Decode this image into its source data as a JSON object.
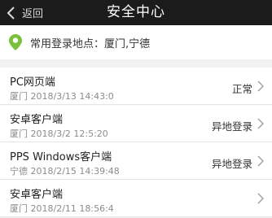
{
  "header": {
    "back_label": "返回",
    "title": "安全中心"
  },
  "location": {
    "icon": "location-pin-icon",
    "text": "常用登录地点：厦门,宁德",
    "accent": "#7bbf3a"
  },
  "devices": [
    {
      "name": "PC网页端",
      "place": "厦门",
      "time": "2018/3/13 14:43:0",
      "status": "正常"
    },
    {
      "name": "安卓客户端",
      "place": "厦门",
      "time": "2018/3/2 12:5:20",
      "status": "异地登录"
    },
    {
      "name": "PPS Windows客户端",
      "place": "宁德",
      "time": "2018/2/15 14:39:48",
      "status": "异地登录"
    },
    {
      "name": "安卓客户端",
      "place": "厦门",
      "time": "2018/2/11 18:56:4",
      "status": ""
    }
  ]
}
